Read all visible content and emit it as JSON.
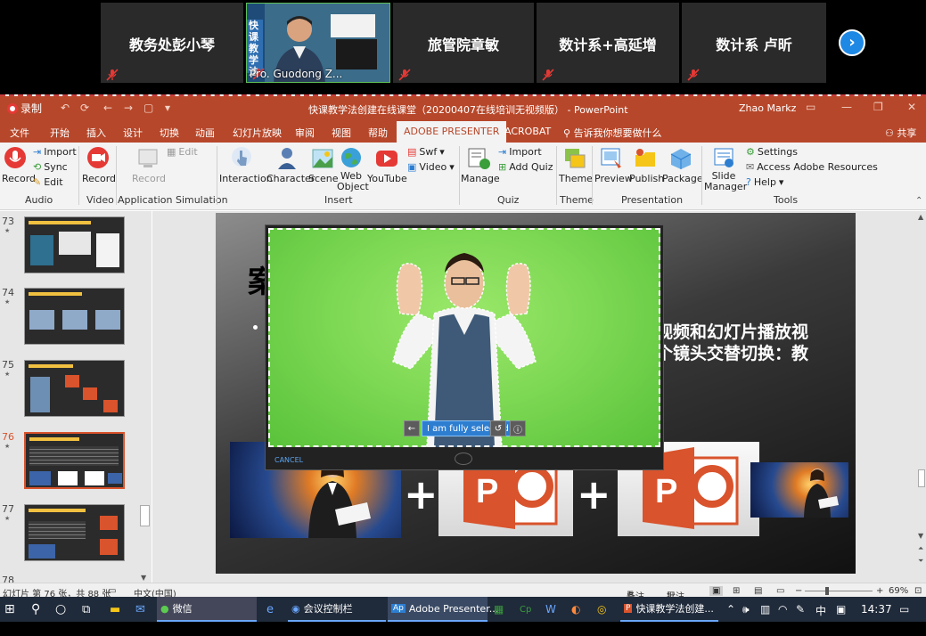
{
  "meeting": {
    "participants": [
      {
        "name": "教务处彭小琴",
        "muted": true
      },
      {
        "name": "Pro. Guodong Z...",
        "muted": true,
        "video": true
      },
      {
        "name": "旅管院章敏",
        "muted": true
      },
      {
        "name": "数计系+高延增",
        "muted": true
      },
      {
        "name": "数计系 卢昕",
        "muted": true
      }
    ],
    "video_sign_text": "快课教学法",
    "next_icon": "chevron-right-icon"
  },
  "ppt": {
    "recording_label": "录制",
    "window_title": "快课教学法创建在线课堂（20200407在线培训无视频版） - PowerPoint",
    "user": "Zhao Markz",
    "menu": [
      "文件",
      "开始",
      "插入",
      "设计",
      "切换",
      "动画",
      "幻灯片放映",
      "审阅",
      "视图",
      "帮助",
      "ADOBE PRESENTER",
      "ACROBAT"
    ],
    "tell_me": "告诉我你想要做什么",
    "share": "共享",
    "ribbon": {
      "audio": {
        "record": "Record",
        "import": "Import",
        "sync": "Sync",
        "edit": "Edit",
        "group": "Audio"
      },
      "video": {
        "record": "Record",
        "group": "Video"
      },
      "appsim": {
        "record": "Record",
        "edit": "Edit",
        "group": "Application Simulation"
      },
      "insert": {
        "interaction": "Interaction",
        "character": "Character",
        "scene": "Scene",
        "web_object": "Web Object",
        "youtube": "YouTube",
        "swf": "Swf",
        "video": "Video",
        "group": "Insert"
      },
      "quiz": {
        "manage": "Manage",
        "import": "Import",
        "add_quiz": "Add Quiz",
        "group": "Quiz"
      },
      "theme": {
        "theme": "Theme",
        "group": "Theme"
      },
      "presentation": {
        "preview": "Preview",
        "publish": "Publish",
        "package": "Package",
        "group": "Presentation"
      },
      "tools": {
        "slide_manager": "Slide Manager",
        "settings": "Settings",
        "access": "Access Adobe Resources",
        "help": "Help",
        "group": "Tools"
      }
    },
    "thumbnails": [
      {
        "num": "73"
      },
      {
        "num": "74"
      },
      {
        "num": "75"
      },
      {
        "num": "76",
        "selected": true
      },
      {
        "num": "77"
      },
      {
        "num": "78"
      }
    ],
    "slide": {
      "ghost_title": "案",
      "line1": "视频和幻灯片播放视",
      "line2": "个镜头交替切换：教"
    },
    "dialog": {
      "selected_label": "I am fully selected",
      "cancel": "CANCEL"
    },
    "status": {
      "slide_pos": "幻灯片 第 76 张，共 88 张",
      "language": "中文(中国)",
      "notes": "备注",
      "comments": "批注",
      "zoom": "69%"
    }
  },
  "taskbar": {
    "wechat": "微信",
    "meeting_ctrl": "会议控制栏",
    "adobe": "Adobe Presenter...",
    "ppt": "快课教学法创建...",
    "ime1": "中",
    "time": "14:37"
  },
  "colors": {
    "ppt_accent": "#b7472a",
    "mute_red": "#e53935",
    "green_screen": "#7fd955",
    "ppt_icon": "#d9532c"
  }
}
